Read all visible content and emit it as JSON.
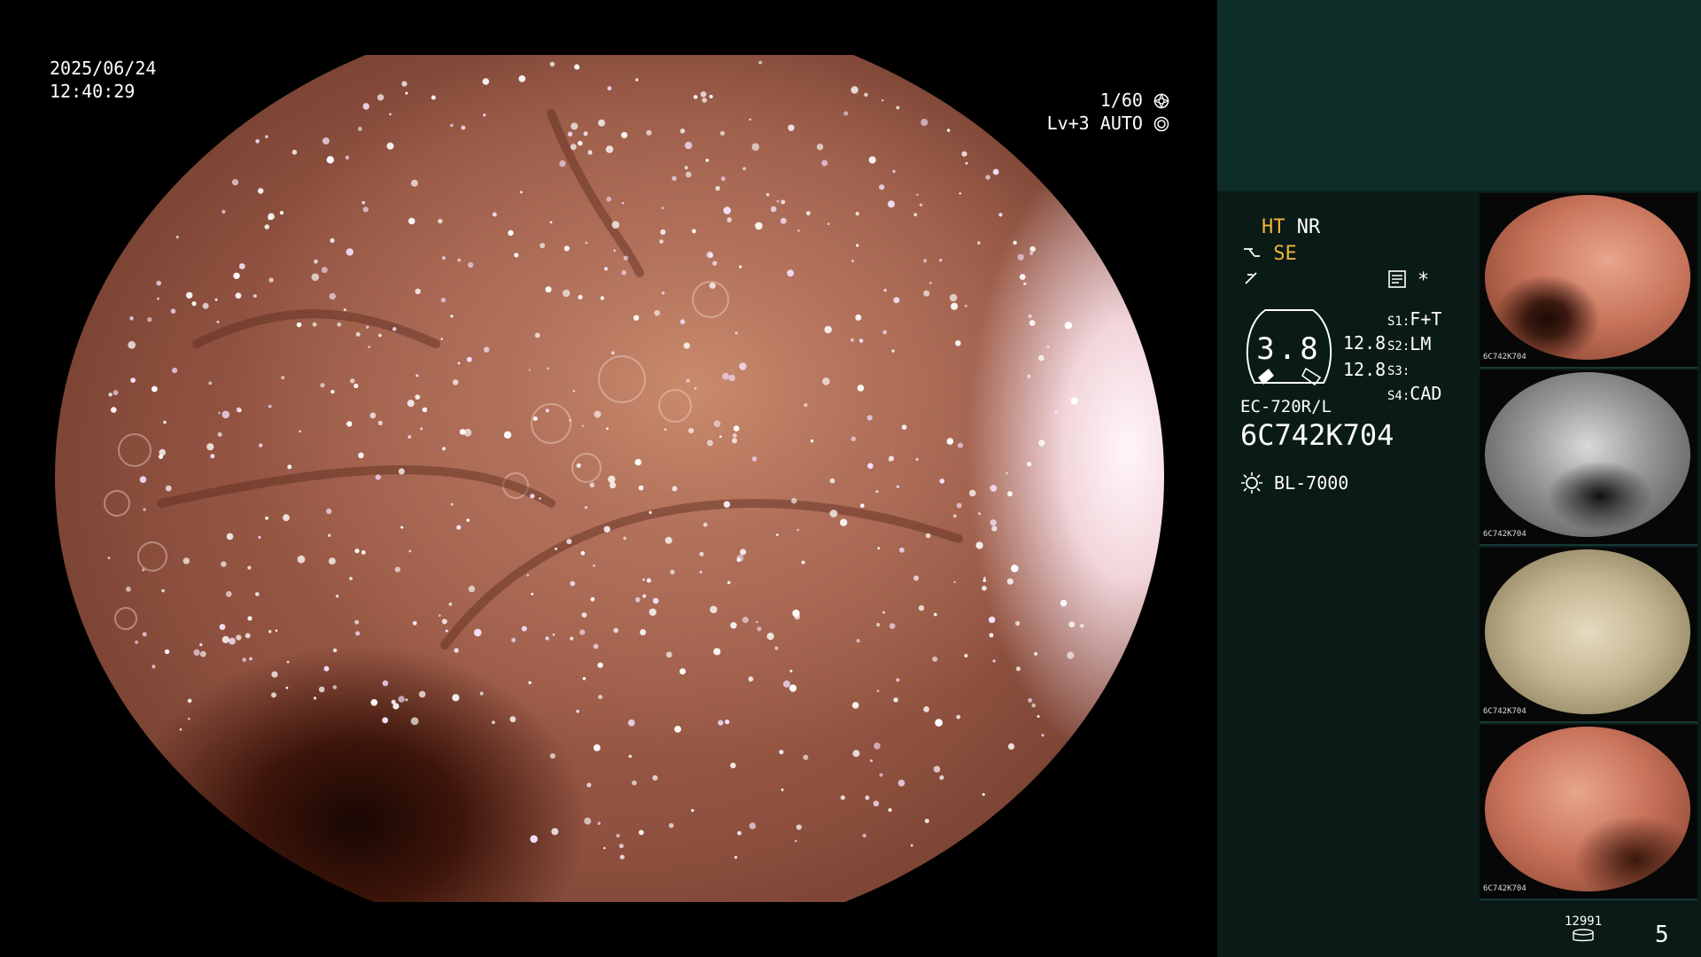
{
  "overlay": {
    "date": "2025/06/24",
    "time": "12:40:29",
    "shutter": "1/60",
    "level": "Lv+3",
    "exposure_mode": "AUTO"
  },
  "panel": {
    "ht": "HT",
    "nr": "NR",
    "se": "SE",
    "zoom_value": "3.8",
    "zoom_side_top": "12.8",
    "zoom_side_bottom": "12.8",
    "s1_label": "S1:",
    "s1_value": "F+T",
    "s2_label": "S2:",
    "s2_value": "LM",
    "s3_label": "S3:",
    "s3_value": "",
    "s4_label": "S4:",
    "s4_value": "CAD",
    "scope_model": "EC-720R/L",
    "serial": "6C742K704",
    "light_source": "BL-7000",
    "asterisk": "*"
  },
  "thumbnails": [
    {
      "label": "6C742K704"
    },
    {
      "label": "6C742K704"
    },
    {
      "label": "6C742K704"
    },
    {
      "label": "6C742K704"
    }
  ],
  "footer": {
    "storage_count": "12991",
    "image_count": "5"
  },
  "icons": {
    "shutter": "aperture-icon",
    "auto": "iris-icon",
    "light": "lamp-icon",
    "storage": "storage-icon",
    "memo": "memo-icon"
  }
}
